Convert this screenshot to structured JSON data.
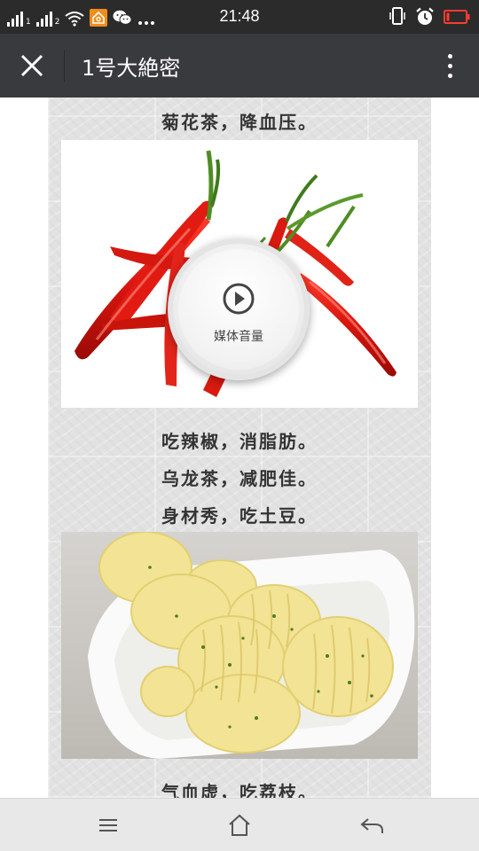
{
  "status_bar": {
    "time": "21:48",
    "sim1_label": "1",
    "sim2_label": "2"
  },
  "header": {
    "title": "1号大絶密"
  },
  "article": {
    "lines": [
      "菊花茶，降血压。",
      "吃辣椒，消脂肪。",
      "乌龙茶，减肥佳。",
      "身材秀，吃土豆。",
      "气血虚，吃荔枝。"
    ]
  },
  "media_overlay": {
    "label": "媒体音量",
    "icon": "play-circle-icon"
  },
  "colors": {
    "status_bar_bg": "#2b2b2b",
    "header_bg": "#393a3e",
    "text": "#333333",
    "nav_bg": "#e8e8e8"
  },
  "icons": {
    "close": "close-icon",
    "more": "more-vertical-icon",
    "menu": "menu-icon",
    "home": "home-icon",
    "back": "back-icon"
  }
}
